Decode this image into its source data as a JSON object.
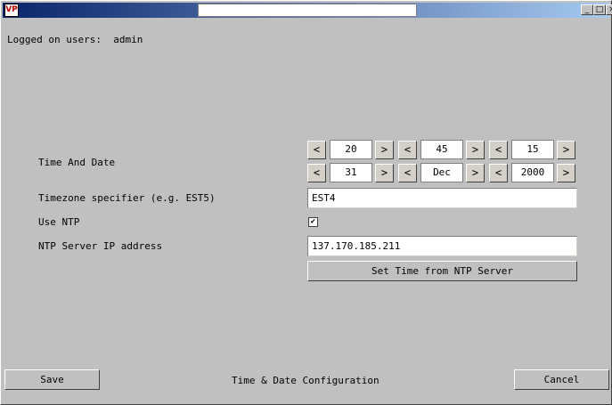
{
  "titlebar": {
    "app_icon": "VP",
    "min": "_",
    "max": "□",
    "close": "×"
  },
  "status": {
    "logged_on": "Logged on users:  admin"
  },
  "time_date": {
    "label": "Time And Date",
    "prev": "<",
    "next": ">",
    "hour": "20",
    "minute": "45",
    "second": "15",
    "day": "31",
    "month": "Dec",
    "year": "2000"
  },
  "timezone": {
    "label": "Timezone specifier (e.g. EST5)",
    "value": "EST4"
  },
  "ntp": {
    "use_label": "Use NTP",
    "checked": "✔",
    "server_label": "NTP Server IP address",
    "server_value": "137.170.185.211",
    "set_button": "Set Time from NTP Server"
  },
  "footer": {
    "save": "Save",
    "title": "Time & Date Configuration",
    "cancel": "Cancel"
  }
}
